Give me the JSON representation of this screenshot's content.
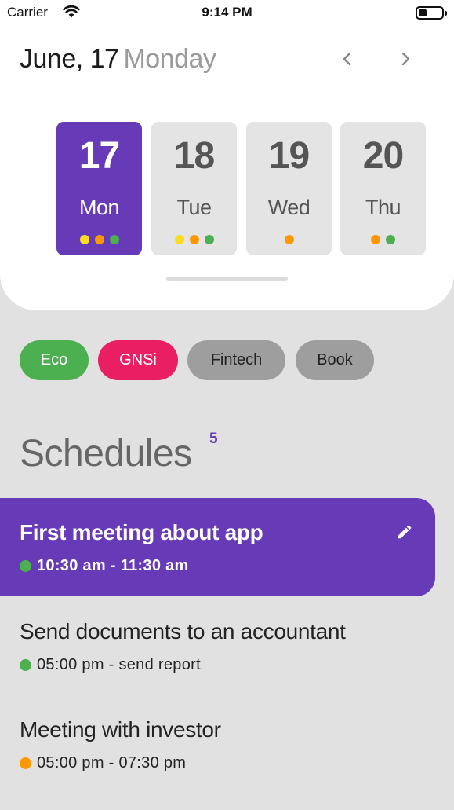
{
  "status_bar": {
    "carrier": "Carrier",
    "time": "9:14 PM"
  },
  "header": {
    "date": "June, 17",
    "weekday": "Monday",
    "prev_icon": "chevron-left-icon",
    "next_icon": "chevron-right-icon"
  },
  "days": [
    {
      "number": "17",
      "name": "Mon",
      "selected": true,
      "dots": [
        "#fddc22",
        "#ff9800",
        "#4caf50"
      ]
    },
    {
      "number": "18",
      "name": "Tue",
      "selected": false,
      "dots": [
        "#fddc22",
        "#ff9800",
        "#4caf50"
      ]
    },
    {
      "number": "19",
      "name": "Wed",
      "selected": false,
      "dots": [
        "#ff9800"
      ]
    },
    {
      "number": "20",
      "name": "Thu",
      "selected": false,
      "dots": [
        "#ff9800",
        "#4caf50"
      ]
    }
  ],
  "tags": [
    {
      "label": "Eco",
      "bg": "#4caf50",
      "color": "#ffffff"
    },
    {
      "label": "GNSi",
      "bg": "#e91e63",
      "color": "#ffffff"
    },
    {
      "label": "Fintech",
      "bg": "#9e9e9e",
      "color": "#222222"
    },
    {
      "label": "Book",
      "bg": "#9e9e9e",
      "color": "#222222"
    }
  ],
  "schedules": {
    "title": "Schedules",
    "count": "5",
    "items": [
      {
        "title": "First meeting about app",
        "subtitle": "10:30 am - 11:30 am",
        "dot": "#4caf50",
        "active": true
      },
      {
        "title": "Send documents to an accountant",
        "subtitle": "05:00 pm - send report",
        "dot": "#4caf50",
        "active": false
      },
      {
        "title": "Meeting with investor",
        "subtitle": "05:00 pm - 07:30 pm",
        "dot": "#ff9800",
        "active": false
      }
    ]
  },
  "colors": {
    "accent": "#673ab7",
    "background": "#e1e1e1"
  }
}
